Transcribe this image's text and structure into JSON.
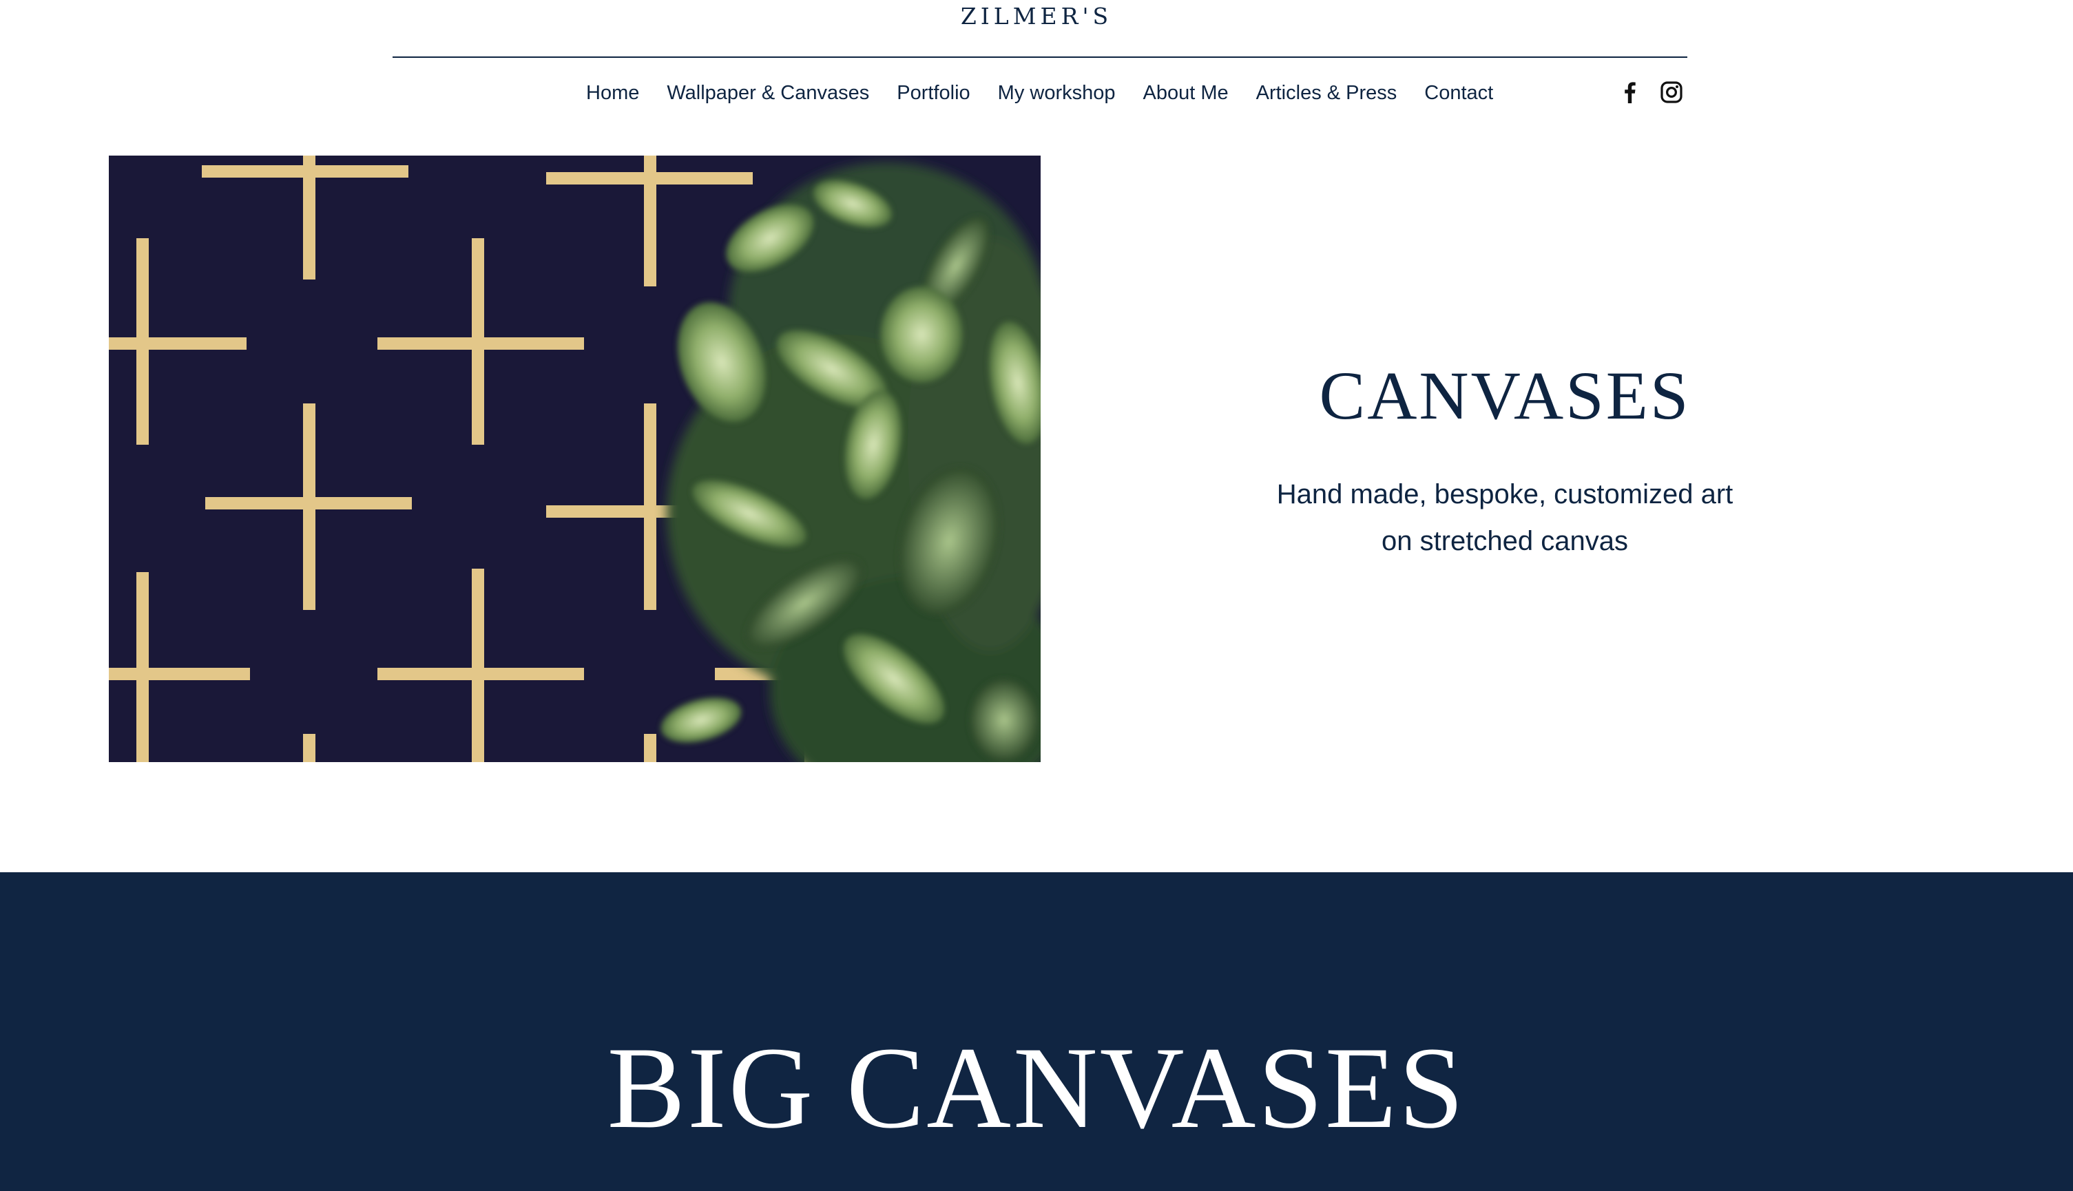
{
  "header": {
    "logo": "ZILMER'S"
  },
  "nav": {
    "items": [
      {
        "label": "Home"
      },
      {
        "label": "Wallpaper & Canvases"
      },
      {
        "label": "Portfolio"
      },
      {
        "label": "My workshop"
      },
      {
        "label": "About Me"
      },
      {
        "label": "Articles & Press"
      },
      {
        "label": "Contact"
      }
    ]
  },
  "social": {
    "icons": [
      "facebook-icon",
      "instagram-icon"
    ]
  },
  "hero": {
    "title": "CANVASES",
    "subtitle_line1": "Hand made, bespoke, customized art",
    "subtitle_line2": "on stretched canvas"
  },
  "band": {
    "title": "BIG CANVASES"
  },
  "colors": {
    "brand_navy": "#0e2441",
    "band_bg": "#102542",
    "image_bg": "#191836",
    "gold": "#e3c789",
    "white": "#ffffff"
  }
}
